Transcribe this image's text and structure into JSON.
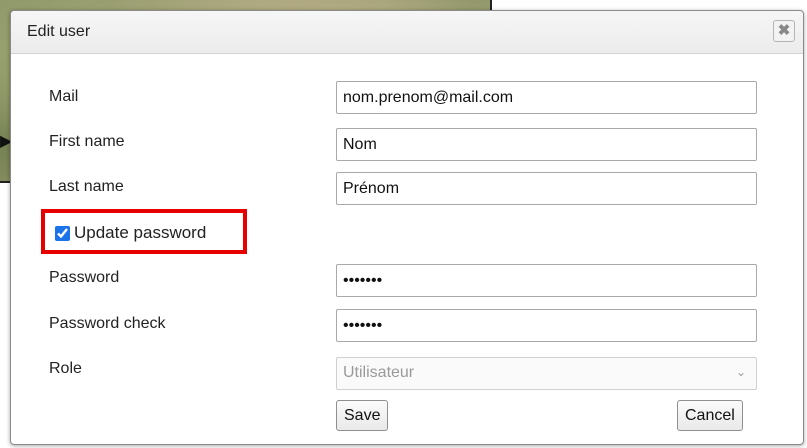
{
  "dialog": {
    "title": "Edit user",
    "close_icon": "close-icon"
  },
  "form": {
    "mail": {
      "label": "Mail",
      "value": "nom.prenom@mail.com"
    },
    "first_name": {
      "label": "First name",
      "value": "Nom"
    },
    "last_name": {
      "label": "Last name",
      "value": "Prénom"
    },
    "update_password": {
      "label": "Update password",
      "checked": true
    },
    "password": {
      "label": "Password",
      "value": "•••••••"
    },
    "password_check": {
      "label": "Password check",
      "value": "•••••••"
    },
    "role": {
      "label": "Role",
      "value": "Utilisateur",
      "disabled": true
    }
  },
  "buttons": {
    "save": "Save",
    "cancel": "Cancel"
  },
  "colors": {
    "highlight": "#e60000",
    "checkbox_accent": "#1a73e8"
  }
}
